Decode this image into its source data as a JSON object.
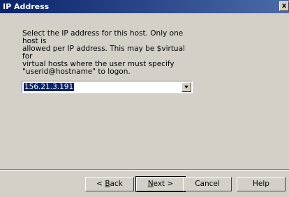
{
  "window": {
    "title": "IP Address",
    "close_label": "x"
  },
  "description": "Select the IP address for this host.  Only one host is\nallowed per IP address.  This may be $virtual for\nvirtual hosts where the user must specify\n\"userid@hostname\" to logon.",
  "ip_select": {
    "selected_value": "156.21.3.191"
  },
  "buttons": {
    "back": {
      "prefix": "< ",
      "mnemonic": "B",
      "rest": "ack"
    },
    "next": {
      "mnemonic": "N",
      "rest": "ext >"
    },
    "cancel": "Cancel",
    "help": "Help"
  },
  "colors": {
    "titlebar": "#0a246a",
    "selection": "#0a246a",
    "face": "#d4d0c8"
  }
}
